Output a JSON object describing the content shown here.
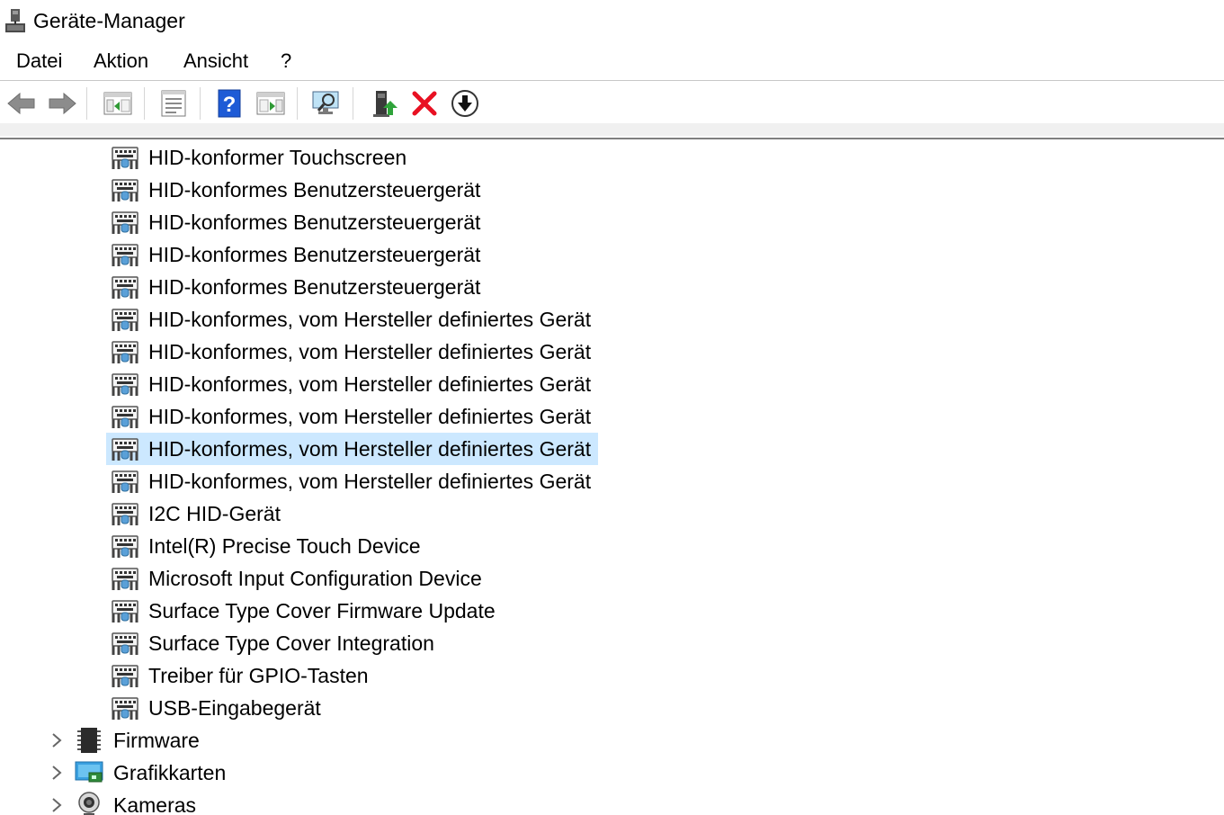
{
  "window": {
    "title": "Geräte-Manager",
    "icon": "device-manager-icon"
  },
  "menu": {
    "items": [
      "Datei",
      "Aktion",
      "Ansicht",
      "?"
    ]
  },
  "toolbar": {
    "buttons": [
      "back-icon",
      "forward-icon",
      "show-hide-console-tree-icon",
      "properties-icon",
      "help-icon",
      "run-action-icon",
      "scan-hardware-icon",
      "update-driver-icon",
      "uninstall-icon",
      "disable-device-icon"
    ]
  },
  "tree": {
    "hid_devices": [
      "HID-konformer Touchscreen",
      "HID-konformes Benutzersteuergerät",
      "HID-konformes Benutzersteuergerät",
      "HID-konformes Benutzersteuergerät",
      "HID-konformes Benutzersteuergerät",
      "HID-konformes, vom Hersteller definiertes Gerät",
      "HID-konformes, vom Hersteller definiertes Gerät",
      "HID-konformes, vom Hersteller definiertes Gerät",
      "HID-konformes, vom Hersteller definiertes Gerät",
      "HID-konformes, vom Hersteller definiertes Gerät",
      "HID-konformes, vom Hersteller definiertes Gerät",
      "I2C HID-Gerät",
      "Intel(R) Precise Touch Device",
      "Microsoft Input Configuration Device",
      "Surface Type Cover Firmware Update",
      "Surface Type Cover Integration",
      "Treiber für GPIO-Tasten",
      "USB-Eingabegerät"
    ],
    "selected_hid_label": "HID-konformes, vom Hersteller definiertes Gerät",
    "categories": [
      {
        "label": "Firmware",
        "icon": "firmware-chip-icon"
      },
      {
        "label": "Grafikkarten",
        "icon": "display-adapter-icon"
      },
      {
        "label": "Kameras",
        "icon": "camera-icon"
      }
    ]
  },
  "colors": {
    "selection": "#cce8ff",
    "delete_red": "#e81123",
    "help_blue": "#1e5bd6"
  }
}
